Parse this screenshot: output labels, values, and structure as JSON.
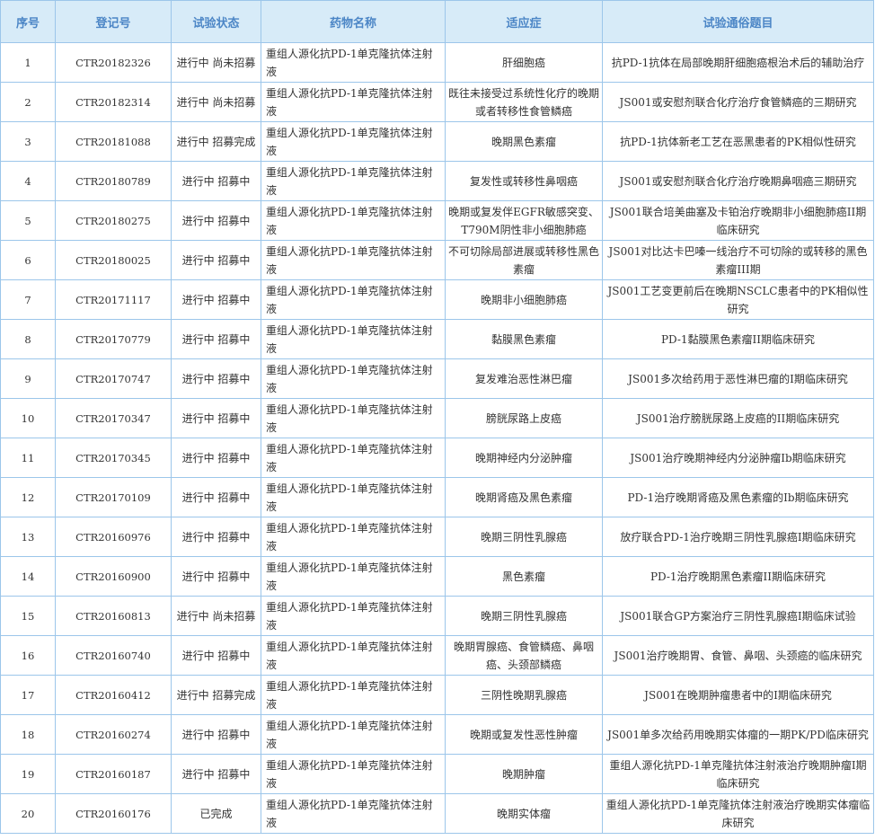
{
  "columns": [
    "序号",
    "登记号",
    "试验状态",
    "药物名称",
    "适应症",
    "试验通俗题目"
  ],
  "rows": [
    {
      "no": "1",
      "reg": "CTR20182326",
      "status": "进行中 尚未招募",
      "drug": "重组人源化抗PD-1单克隆抗体注射液",
      "indication": "肝细胞癌",
      "title": "抗PD-1抗体在局部晚期肝细胞癌根治术后的辅助治疗"
    },
    {
      "no": "2",
      "reg": "CTR20182314",
      "status": "进行中 尚未招募",
      "drug": "重组人源化抗PD-1单克隆抗体注射液",
      "indication": "既往未接受过系统性化疗的晚期或者转移性食管鳞癌",
      "title": "JS001或安慰剂联合化疗治疗食管鳞癌的三期研究"
    },
    {
      "no": "3",
      "reg": "CTR20181088",
      "status": "进行中 招募完成",
      "drug": "重组人源化抗PD-1单克隆抗体注射液",
      "indication": "晚期黑色素瘤",
      "title": "抗PD-1抗体新老工艺在恶黑患者的PK相似性研究"
    },
    {
      "no": "4",
      "reg": "CTR20180789",
      "status": "进行中 招募中",
      "drug": "重组人源化抗PD-1单克隆抗体注射液",
      "indication": "复发性或转移性鼻咽癌",
      "title": "JS001或安慰剂联合化疗治疗晚期鼻咽癌三期研究"
    },
    {
      "no": "5",
      "reg": "CTR20180275",
      "status": "进行中 招募中",
      "drug": "重组人源化抗PD-1单克隆抗体注射液",
      "indication": "晚期或复发伴EGFR敏感突变、T790M阴性非小细胞肺癌",
      "title": "JS001联合培美曲塞及卡铂治疗晚期非小细胞肺癌II期临床研究"
    },
    {
      "no": "6",
      "reg": "CTR20180025",
      "status": "进行中 招募中",
      "drug": "重组人源化抗PD-1单克隆抗体注射液",
      "indication": "不可切除局部进展或转移性黑色素瘤",
      "title": "JS001对比达卡巴嗪一线治疗不可切除的或转移的黑色素瘤III期"
    },
    {
      "no": "7",
      "reg": "CTR20171117",
      "status": "进行中 招募中",
      "drug": "重组人源化抗PD-1单克隆抗体注射液",
      "indication": "晚期非小细胞肺癌",
      "title": "JS001工艺变更前后在晚期NSCLC患者中的PK相似性研究"
    },
    {
      "no": "8",
      "reg": "CTR20170779",
      "status": "进行中 招募中",
      "drug": "重组人源化抗PD-1单克隆抗体注射液",
      "indication": "黏膜黑色素瘤",
      "title": "PD-1黏膜黑色素瘤II期临床研究"
    },
    {
      "no": "9",
      "reg": "CTR20170747",
      "status": "进行中 招募中",
      "drug": "重组人源化抗PD-1单克隆抗体注射液",
      "indication": "复发难治恶性淋巴瘤",
      "title": "JS001多次给药用于恶性淋巴瘤的I期临床研究"
    },
    {
      "no": "10",
      "reg": "CTR20170347",
      "status": "进行中 招募中",
      "drug": "重组人源化抗PD-1单克隆抗体注射液",
      "indication": "膀胱尿路上皮癌",
      "title": "JS001治疗膀胱尿路上皮癌的II期临床研究"
    },
    {
      "no": "11",
      "reg": "CTR20170345",
      "status": "进行中 招募中",
      "drug": "重组人源化抗PD-1单克隆抗体注射液",
      "indication": "晚期神经内分泌肿瘤",
      "title": "JS001治疗晚期神经内分泌肿瘤Ib期临床研究"
    },
    {
      "no": "12",
      "reg": "CTR20170109",
      "status": "进行中 招募中",
      "drug": "重组人源化抗PD-1单克隆抗体注射液",
      "indication": "晚期肾癌及黑色素瘤",
      "title": "PD-1治疗晚期肾癌及黑色素瘤的Ib期临床研究"
    },
    {
      "no": "13",
      "reg": "CTR20160976",
      "status": "进行中 招募中",
      "drug": "重组人源化抗PD-1单克隆抗体注射液",
      "indication": "晚期三阴性乳腺癌",
      "title": "放疗联合PD-1治疗晚期三阴性乳腺癌I期临床研究"
    },
    {
      "no": "14",
      "reg": "CTR20160900",
      "status": "进行中 招募中",
      "drug": "重组人源化抗PD-1单克隆抗体注射液",
      "indication": "黑色素瘤",
      "title": "PD-1治疗晚期黑色素瘤II期临床研究"
    },
    {
      "no": "15",
      "reg": "CTR20160813",
      "status": "进行中 尚未招募",
      "drug": "重组人源化抗PD-1单克隆抗体注射液",
      "indication": "晚期三阴性乳腺癌",
      "title": "JS001联合GP方案治疗三阴性乳腺癌I期临床试验"
    },
    {
      "no": "16",
      "reg": "CTR20160740",
      "status": "进行中 招募中",
      "drug": "重组人源化抗PD-1单克隆抗体注射液",
      "indication": "晚期胃腺癌、食管鳞癌、鼻咽癌、头颈部鳞癌",
      "title": "JS001治疗晚期胃、食管、鼻咽、头颈癌的临床研究"
    },
    {
      "no": "17",
      "reg": "CTR20160412",
      "status": "进行中 招募完成",
      "drug": "重组人源化抗PD-1单克隆抗体注射液",
      "indication": "三阴性晚期乳腺癌",
      "title": "JS001在晚期肿瘤患者中的I期临床研究"
    },
    {
      "no": "18",
      "reg": "CTR20160274",
      "status": "进行中 招募中",
      "drug": "重组人源化抗PD-1单克隆抗体注射液",
      "indication": "晚期或复发性恶性肿瘤",
      "title": "JS001单多次给药用晚期实体瘤的一期PK/PD临床研究"
    },
    {
      "no": "19",
      "reg": "CTR20160187",
      "status": "进行中 招募中",
      "drug": "重组人源化抗PD-1单克隆抗体注射液",
      "indication": "晚期肿瘤",
      "title": "重组人源化抗PD-1单克隆抗体注射液治疗晚期肿瘤I期临床研究"
    },
    {
      "no": "20",
      "reg": "CTR20160176",
      "status": "已完成",
      "drug": "重组人源化抗PD-1单克隆抗体注射液",
      "indication": "晚期实体瘤",
      "title": "重组人源化抗PD-1单克隆抗体注射液治疗晚期实体瘤临床研究"
    }
  ]
}
